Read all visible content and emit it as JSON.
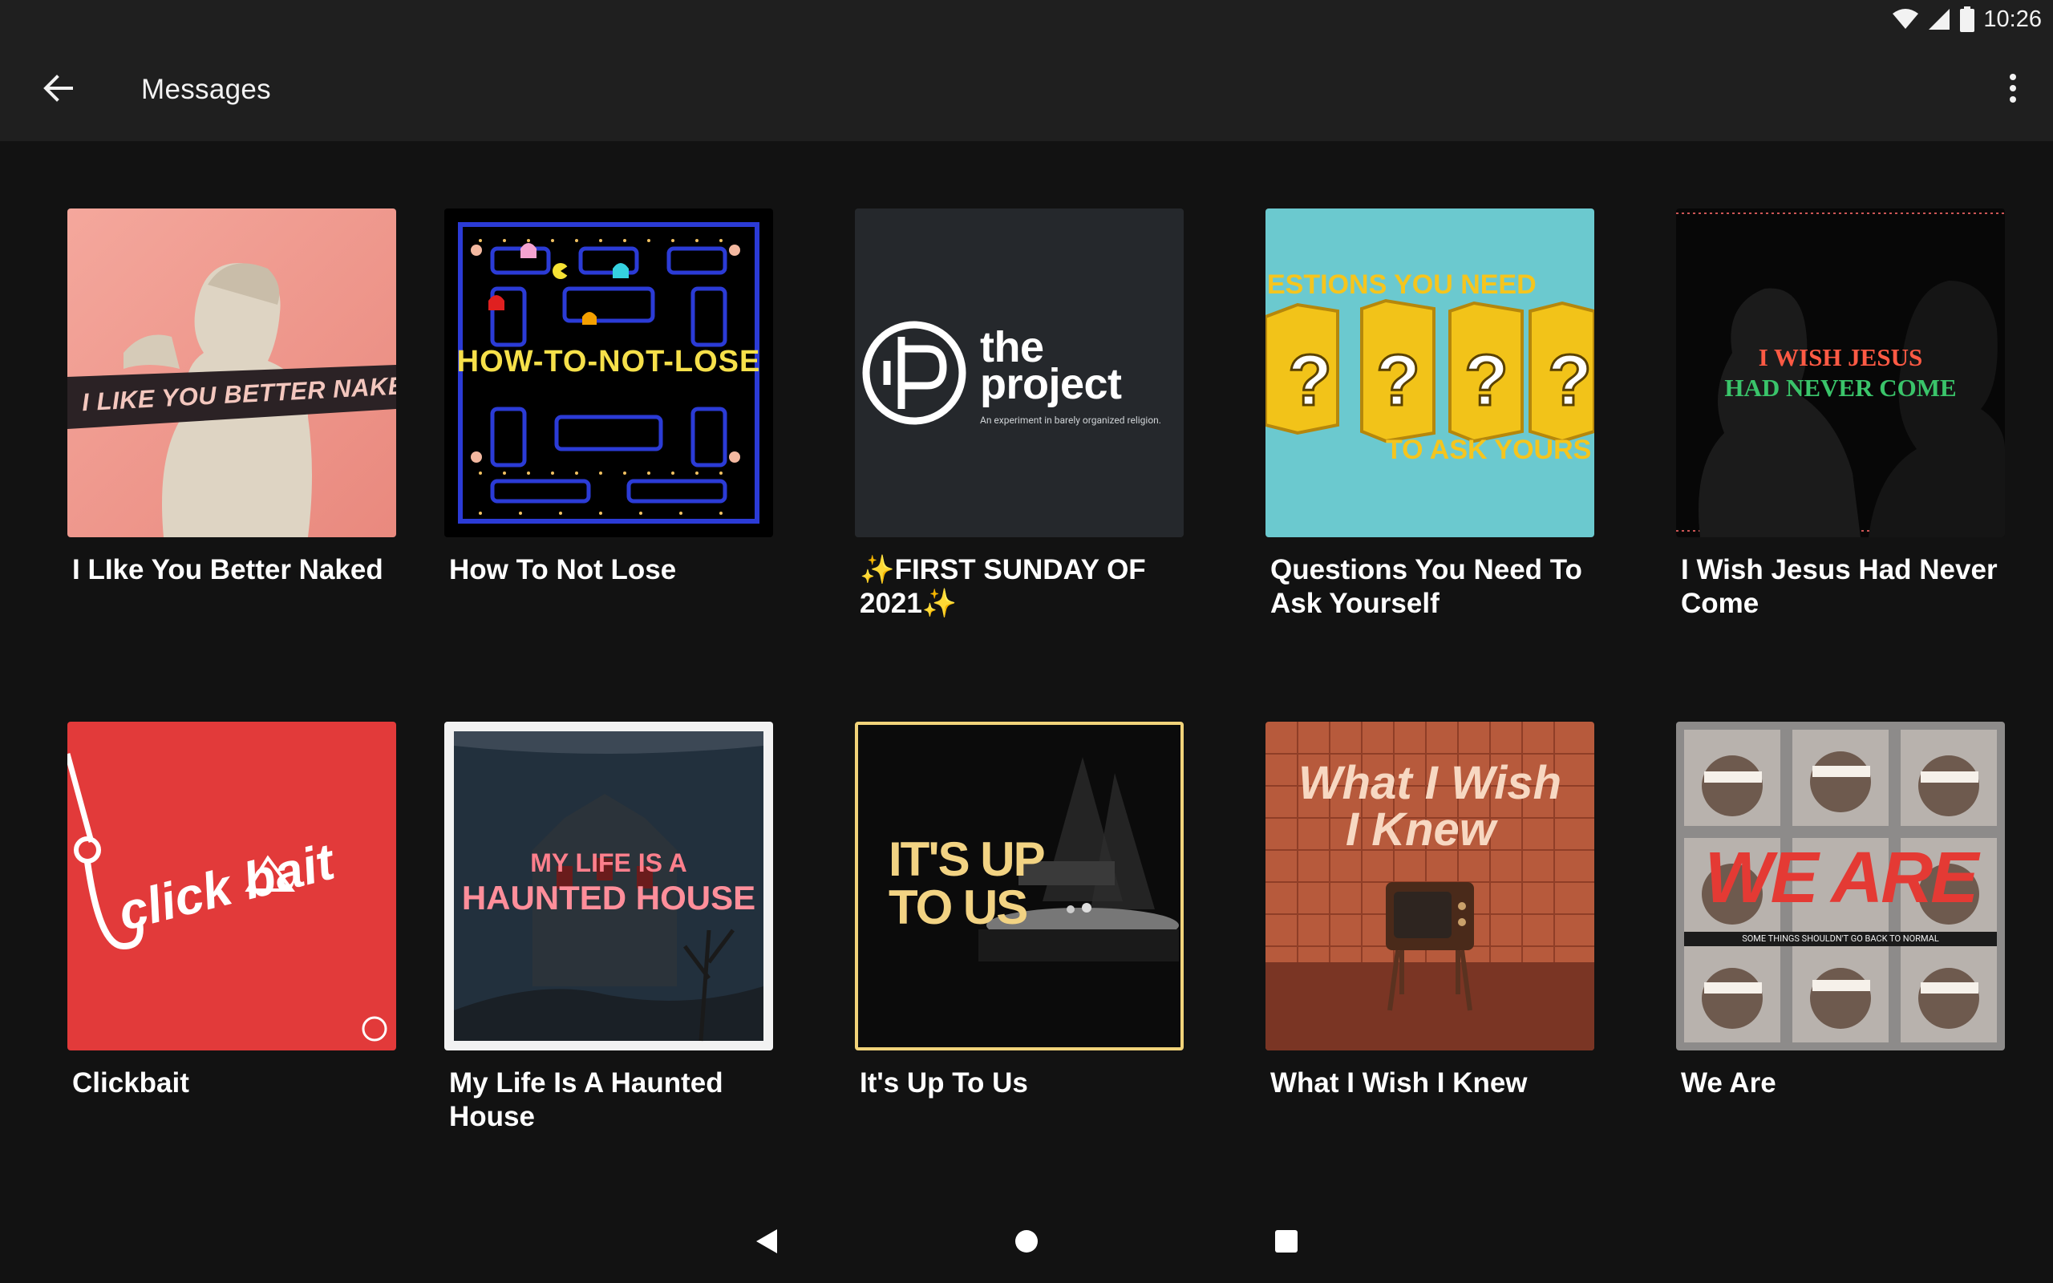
{
  "status_bar": {
    "time": "10:26",
    "icons": [
      "wifi-icon",
      "cell-signal-icon",
      "battery-icon"
    ]
  },
  "app_bar": {
    "title": "Messages",
    "back_icon": "arrow-back-icon",
    "overflow_icon": "more-vert-icon"
  },
  "messages": [
    {
      "title": "I LIke You Better Naked",
      "art_text": "I LIKE YOU BETTER NAKED"
    },
    {
      "title": "How To Not Lose",
      "art_text": "HOW-TO-NOT-LOSE"
    },
    {
      "title": "✨FIRST SUNDAY OF 2021✨",
      "art_text": "the project",
      "art_subtext": "An experiment in barely organized religion."
    },
    {
      "title": "Questions You Need To Ask Yourself",
      "art_text": "ESTIONS YOU NEED",
      "art_subtext": "TO ASK YOURS"
    },
    {
      "title": "I Wish Jesus Had Never Come",
      "art_text": "I WISH JESUS",
      "art_subtext": "HAD NEVER COME"
    },
    {
      "title": "Clickbait",
      "art_text": "click bait"
    },
    {
      "title": "My Life Is A Haunted House",
      "art_text": "MY LIFE IS A",
      "art_subtext": "HAUNTED HOUSE"
    },
    {
      "title": "It's Up To Us",
      "art_text": "IT'S UP",
      "art_subtext": "TO US"
    },
    {
      "title": "What I Wish I Knew",
      "art_text": "What I Wish",
      "art_subtext": "I Knew"
    },
    {
      "title": "We Are",
      "art_text": "WE ARE",
      "art_subtext": "SOME THINGS SHOULDN'T GO BACK TO NORMAL"
    }
  ],
  "nav_bar": {
    "back_icon": "nav-back-triangle-icon",
    "home_icon": "nav-home-circle-icon",
    "recents_icon": "nav-recents-square-icon"
  },
  "colors": {
    "background": "#121212",
    "app_bar": "#1f1f1f",
    "text": "#ffffff"
  }
}
